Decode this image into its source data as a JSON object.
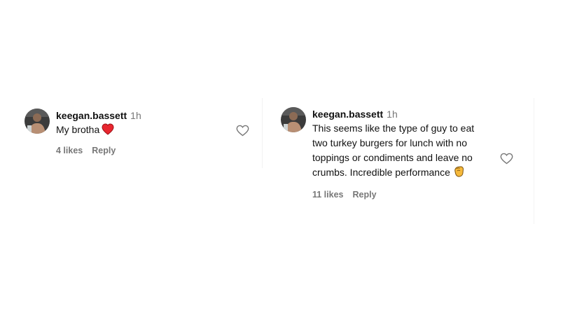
{
  "comments": [
    {
      "username": "keegan.bassett",
      "time": "1h",
      "text": "My brotha",
      "emoji": "red-heart-icon",
      "likes": "4 likes",
      "reply": "Reply"
    },
    {
      "username": "keegan.bassett",
      "time": "1h",
      "text": "This seems like the type of guy to eat two turkey burgers for lunch with no toppings or condiments and leave no crumbs. Incredible performance",
      "emoji": "clapping-hands-icon",
      "likes": "11 likes",
      "reply": "Reply"
    }
  ],
  "colors": {
    "secondary_text": "#777777",
    "heart_emoji": "#e8262f",
    "clap_emoji": "#f6b93b"
  }
}
